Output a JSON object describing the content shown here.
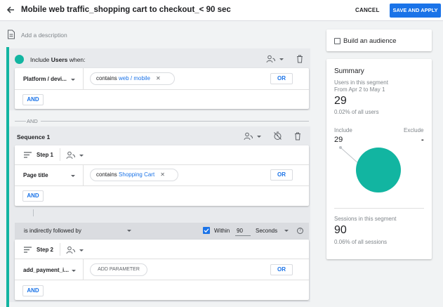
{
  "header": {
    "title": "Mobile web traffic_shopping cart to checkout_< 90 sec",
    "cancel_label": "CANCEL",
    "save_label": "SAVE AND APPLY"
  },
  "description_placeholder": "Add a description",
  "include_block": {
    "prefix": "Include ",
    "scope": "Users",
    "suffix": " when:",
    "dimension": "Platform / devi...",
    "condition_prefix": "contains ",
    "condition_value": "web / mobile",
    "or_label": "OR",
    "and_label": "AND"
  },
  "and_separator": "AND",
  "sequence": {
    "title": "Sequence 1",
    "step1": {
      "label": "Step 1",
      "dimension": "Page title",
      "condition_prefix": "contains ",
      "condition_value": "Shopping Cart",
      "or_label": "OR",
      "and_label": "AND"
    },
    "followed_by": "is indirectly followed by",
    "within_label": "Within",
    "within_value": "90",
    "within_unit": "Seconds",
    "help": "?",
    "step2": {
      "label": "Step 2",
      "dimension": "add_payment_i...",
      "add_parameter": "ADD PARAMETER",
      "or_label": "OR",
      "and_label": "AND"
    }
  },
  "audience": {
    "label": "Build an audience",
    "checked": false
  },
  "summary": {
    "title": "Summary",
    "users_label": "Users in this segment",
    "date_range": "From Apr 2 to May 1",
    "users_value": "29",
    "users_pct": "0.02% of all users",
    "include_label": "Include",
    "exclude_label": "Exclude",
    "include_value": "29",
    "exclude_value": "-",
    "sessions_label": "Sessions in this segment",
    "sessions_value": "90",
    "sessions_pct": "0.06% of all sessions"
  },
  "colors": {
    "accent": "#1a73e8",
    "teal": "#12b5a1",
    "pie": "#12b5a1"
  },
  "chart_data": {
    "type": "pie",
    "categories": [
      "Include",
      "Exclude"
    ],
    "values": [
      29,
      0
    ]
  }
}
